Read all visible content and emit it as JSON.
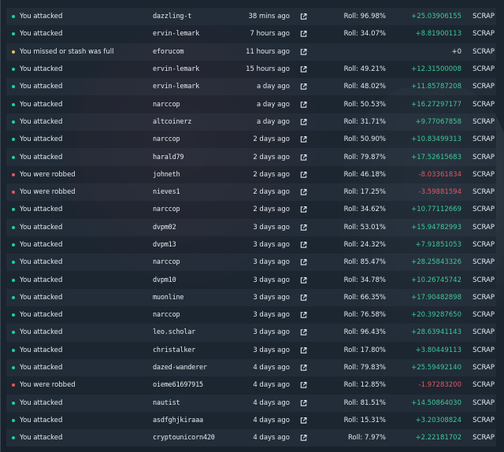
{
  "colors": {
    "success": "#19d3a2",
    "missed": "#e8c267",
    "robbed": "#e2585f",
    "amount_positive": "#3ec898",
    "amount_negative": "#e2585f",
    "amount_zero": "#e4e8ec"
  },
  "unit_label": "SCRAP",
  "roll_prefix": "Roll:",
  "rows": [
    {
      "status": "success",
      "action": "You attacked",
      "user": "dazzling-t",
      "time": "38 mins ago",
      "roll": "96.98%",
      "amount": "+25.03906155"
    },
    {
      "status": "success",
      "action": "You attacked",
      "user": "ervin-lemark",
      "time": "7 hours ago",
      "roll": "34.07%",
      "amount": "+8.81900113"
    },
    {
      "status": "missed",
      "action": "You missed or stash was full",
      "user": "eforucom",
      "time": "11 hours ago",
      "roll": "",
      "amount": "+0"
    },
    {
      "status": "success",
      "action": "You attacked",
      "user": "ervin-lemark",
      "time": "15 hours ago",
      "roll": "49.21%",
      "amount": "+12.31500008"
    },
    {
      "status": "success",
      "action": "You attacked",
      "user": "ervin-lemark",
      "time": "a day ago",
      "roll": "48.02%",
      "amount": "+11.85787208"
    },
    {
      "status": "success",
      "action": "You attacked",
      "user": "narccop",
      "time": "a day ago",
      "roll": "50.53%",
      "amount": "+16.27297177"
    },
    {
      "status": "success",
      "action": "You attacked",
      "user": "altcoinerz",
      "time": "a day ago",
      "roll": "31.71%",
      "amount": "+9.77067858"
    },
    {
      "status": "success",
      "action": "You attacked",
      "user": "narccop",
      "time": "2 days ago",
      "roll": "50.90%",
      "amount": "+10.83499313"
    },
    {
      "status": "success",
      "action": "You attacked",
      "user": "harald79",
      "time": "2 days ago",
      "roll": "79.87%",
      "amount": "+17.52615683"
    },
    {
      "status": "robbed",
      "action": "You were robbed",
      "user": "johneth",
      "time": "2 days ago",
      "roll": "46.18%",
      "amount": "-8.03361834"
    },
    {
      "status": "robbed",
      "action": "You were robbed",
      "user": "nieves1",
      "time": "2 days ago",
      "roll": "17.25%",
      "amount": "-3.59881594"
    },
    {
      "status": "success",
      "action": "You attacked",
      "user": "narccop",
      "time": "2 days ago",
      "roll": "34.62%",
      "amount": "+10.77112669"
    },
    {
      "status": "success",
      "action": "You attacked",
      "user": "dvpm02",
      "time": "3 days ago",
      "roll": "53.01%",
      "amount": "+15.94782993"
    },
    {
      "status": "success",
      "action": "You attacked",
      "user": "dvpm13",
      "time": "3 days ago",
      "roll": "24.32%",
      "amount": "+7.91851053"
    },
    {
      "status": "success",
      "action": "You attacked",
      "user": "narccop",
      "time": "3 days ago",
      "roll": "85.47%",
      "amount": "+28.25843326"
    },
    {
      "status": "success",
      "action": "You attacked",
      "user": "dvpm10",
      "time": "3 days ago",
      "roll": "34.78%",
      "amount": "+10.26745742"
    },
    {
      "status": "success",
      "action": "You attacked",
      "user": "muonline",
      "time": "3 days ago",
      "roll": "66.35%",
      "amount": "+17.90482898"
    },
    {
      "status": "success",
      "action": "You attacked",
      "user": "narccop",
      "time": "3 days ago",
      "roll": "76.58%",
      "amount": "+20.39287650"
    },
    {
      "status": "success",
      "action": "You attacked",
      "user": "leo.scholar",
      "time": "3 days ago",
      "roll": "96.43%",
      "amount": "+28.63941143"
    },
    {
      "status": "success",
      "action": "You attacked",
      "user": "christalker",
      "time": "3 days ago",
      "roll": "17.80%",
      "amount": "+3.80449113"
    },
    {
      "status": "success",
      "action": "You attacked",
      "user": "dazed-wanderer",
      "time": "4 days ago",
      "roll": "79.83%",
      "amount": "+25.59492140"
    },
    {
      "status": "robbed",
      "action": "You were robbed",
      "user": "oieme61697915",
      "time": "4 days ago",
      "roll": "12.85%",
      "amount": "-1.97283200"
    },
    {
      "status": "success",
      "action": "You attacked",
      "user": "nautist",
      "time": "4 days ago",
      "roll": "81.51%",
      "amount": "+14.50864030"
    },
    {
      "status": "success",
      "action": "You attacked",
      "user": "asdfghjkiraaa",
      "time": "4 days ago",
      "roll": "15.31%",
      "amount": "+3.20308824"
    },
    {
      "status": "success",
      "action": "You attacked",
      "user": "cryptounicorn420",
      "time": "4 days ago",
      "roll": "7.97%",
      "amount": "+2.22181702"
    }
  ]
}
